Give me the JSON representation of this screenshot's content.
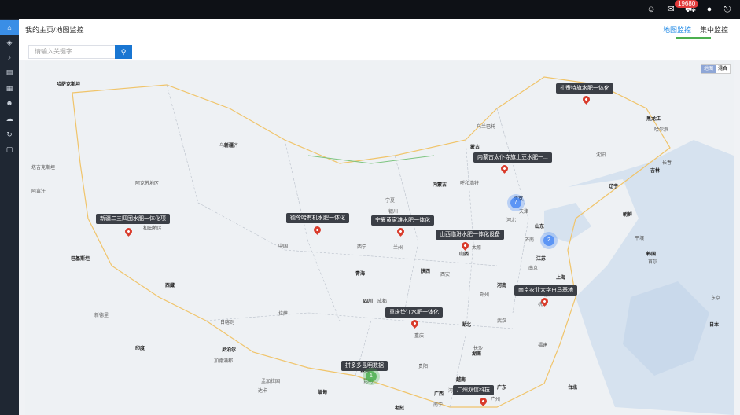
{
  "topbar": {
    "badge_count": "19680",
    "icons": [
      "smile-icon",
      "mail-icon",
      "cart-icon",
      "user-icon",
      "logout-icon"
    ]
  },
  "sidebar": {
    "icons": [
      "home-icon",
      "cube-icon",
      "bell-icon",
      "clipboard-icon",
      "grid-icon",
      "user-icon",
      "cloud-icon",
      "refresh-icon",
      "document-icon"
    ]
  },
  "header": {
    "breadcrumb": "我的主页/地图监控",
    "tabs": [
      {
        "label": "地图监控",
        "active": true
      },
      {
        "label": "集中监控",
        "active": false
      }
    ]
  },
  "search": {
    "placeholder": "请输入关键字"
  },
  "map": {
    "map_type": {
      "map": "地图",
      "hybrid": "混合"
    },
    "sites": [
      {
        "label": "扎赉特旗水肥一体化"
      },
      {
        "label": "内蒙古太仆寺旗土豆水肥一..."
      },
      {
        "label": "新疆二三四团水肥一体化项"
      },
      {
        "label": "德令哈有机水肥一体化"
      },
      {
        "label": "宁夏黄家滩水肥一体化"
      },
      {
        "label": "山西临汾水肥一体化设备"
      },
      {
        "label": "南京农业大学白马基地"
      },
      {
        "label": "重庆垫江水肥一体化"
      },
      {
        "label": "拼多多昆明数据"
      },
      {
        "label": "广州双信科技"
      }
    ],
    "clusters": [
      "7",
      "2",
      "1"
    ],
    "places": [
      "新疆",
      "乌鲁木齐",
      "阿克苏地区",
      "和田地区",
      "青海",
      "西宁",
      "兰州",
      "西藏",
      "拉萨",
      "日喀则",
      "四川",
      "成都",
      "重庆",
      "云南",
      "昆明",
      "贵阳",
      "广西",
      "南宁",
      "广东",
      "广州",
      "湖南",
      "长沙",
      "湖北",
      "武汉",
      "河南",
      "郑州",
      "山西",
      "太原",
      "陕西",
      "西安",
      "北京",
      "天津",
      "河北",
      "山东",
      "济南",
      "江苏",
      "南京",
      "上海",
      "浙江",
      "杭州",
      "福建",
      "台北",
      "内蒙古",
      "呼和浩特",
      "宁夏",
      "银川",
      "辽宁",
      "沈阳",
      "吉林",
      "长春",
      "黑龙江",
      "哈尔滨",
      "首尔",
      "平壤",
      "东京",
      "印度",
      "新德里",
      "巴基斯坦",
      "尼泊尔",
      "加德满都",
      "孟加拉国",
      "达卡",
      "缅甸",
      "老挝",
      "越南",
      "河内",
      "蒙古",
      "乌兰巴托",
      "哈萨克斯坦",
      "塔吉克斯坦",
      "阿富汗",
      "日本",
      "韩国",
      "朝鲜",
      "中国"
    ],
    "colors": {
      "land": "#eef1f4",
      "sea": "#d6e2ef",
      "border": "#f0c46a",
      "pin": "#d93b2b",
      "cluster": "#4285f4"
    }
  }
}
